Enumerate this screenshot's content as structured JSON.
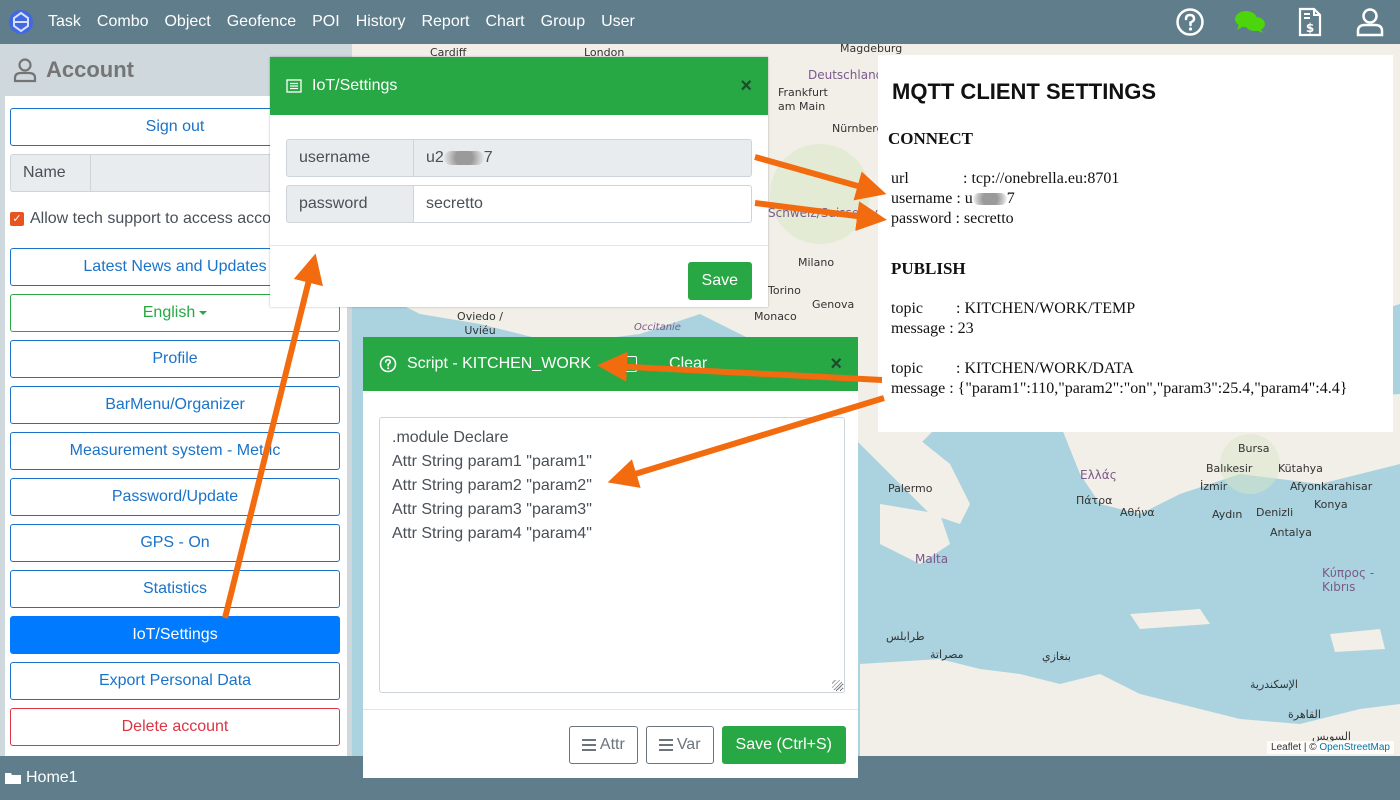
{
  "topbar": {
    "logo_icon": "globe-logo-icon",
    "nav": [
      "Task",
      "Combo",
      "Object",
      "Geofence",
      "POI",
      "History",
      "Report",
      "Chart",
      "Group",
      "User"
    ],
    "right_icons": [
      "help-icon",
      "chat-icon",
      "invoice-icon",
      "user-icon"
    ],
    "chat_icon_color": "#4cd40d"
  },
  "account": {
    "title": "Account",
    "sign_out": "Sign out",
    "name_label": "Name",
    "name_value": "",
    "allow_support": "Allow tech support to access account",
    "allow_support_checked": true,
    "buttons": {
      "news": "Latest News and Updates",
      "language": "English",
      "profile": "Profile",
      "barmenu": "BarMenu/Organizer",
      "measurement": "Measurement system - Metric",
      "password": "Password/Update",
      "gps": "GPS - On",
      "statistics": "Statistics",
      "iot": "IoT/Settings",
      "export": "Export Personal Data",
      "delete": "Delete account"
    }
  },
  "iot_modal": {
    "title": "IoT/Settings",
    "username_label": "username",
    "username_value_prefix": "u2",
    "username_value_suffix": "7",
    "password_label": "password",
    "password_value": "secretto",
    "save": "Save",
    "close": "×"
  },
  "script_modal": {
    "title": "Script - KITCHEN_WORK",
    "clear": "Clear",
    "close": "×",
    "lines": [
      ".module Declare",
      "Attr String param1 \"param1\"",
      "Attr String param2 \"param2\"",
      "Attr String param3 \"param3\"",
      "Attr String param4 \"param4\""
    ],
    "attr_btn": "Attr",
    "var_btn": "Var",
    "save_btn": "Save (Ctrl+S)"
  },
  "mqtt": {
    "title": "MQTT CLIENT SETTINGS",
    "connect_heading": "CONNECT",
    "url_key": "url",
    "url_value": ": tcp://onebrella.eu:8701",
    "username_key": "username",
    "username_value_prefix": ": u",
    "username_value_suffix": "7",
    "password_key": "password",
    "password_value": ": secretto",
    "publish_heading": "PUBLISH",
    "publish": [
      {
        "topic_key": "topic",
        "topic_value": ": KITCHEN/WORK/TEMP",
        "message_key": "message",
        "message_value": ": 23"
      },
      {
        "topic_key": "topic",
        "topic_value": ": KITCHEN/WORK/DATA",
        "message_key": "message",
        "message_value": ": {\"param1\":110,\"param2\":\"on\",\"param3\":25.4,\"param4\":4.4}"
      }
    ]
  },
  "bottombar": {
    "folder": "Home1"
  },
  "map": {
    "labels": {
      "london": "London",
      "cardiff": "Cardiff",
      "magdeburg": "Magdeburg",
      "deutschland": "Deutschland",
      "frankfurt": "Frankfurt am Main",
      "nurnberg": "Nürnberg",
      "schweiz": "Schweiz/Suisse/Svizzera/Svizra",
      "milano": "Milano",
      "torino": "Torino",
      "genova": "Genova",
      "monaco": "Monaco",
      "oviedo": "Oviedo / Uviéu",
      "occitanie": "Occitanie",
      "palermo": "Palermo",
      "malta": "Malta",
      "ellas": "Ελλάς",
      "patra": "Πάτρα",
      "athina": "Αθήνα",
      "bursa": "Bursa",
      "balikesir": "Balıkesir",
      "kutahya": "Kütahya",
      "izmir": "İzmir",
      "afyon": "Afyonkarahisar",
      "konya": "Konya",
      "aydin": "Aydın",
      "denizli": "Denizli",
      "antalya": "Antalya",
      "kypros": "Κύπρος - Kıbrıs",
      "tarabulus": "طرابلس",
      "misrata": "مصراتة",
      "benghazi": "بنغازي",
      "alexandria": "الإسكندرية",
      "cairo": "القاهرة",
      "suez": "السويس"
    },
    "attribution_leaflet": "Leaflet",
    "attribution_sep": " | © ",
    "attribution_osm": "OpenStreetMap"
  },
  "annotation_color": "#f26b0f"
}
